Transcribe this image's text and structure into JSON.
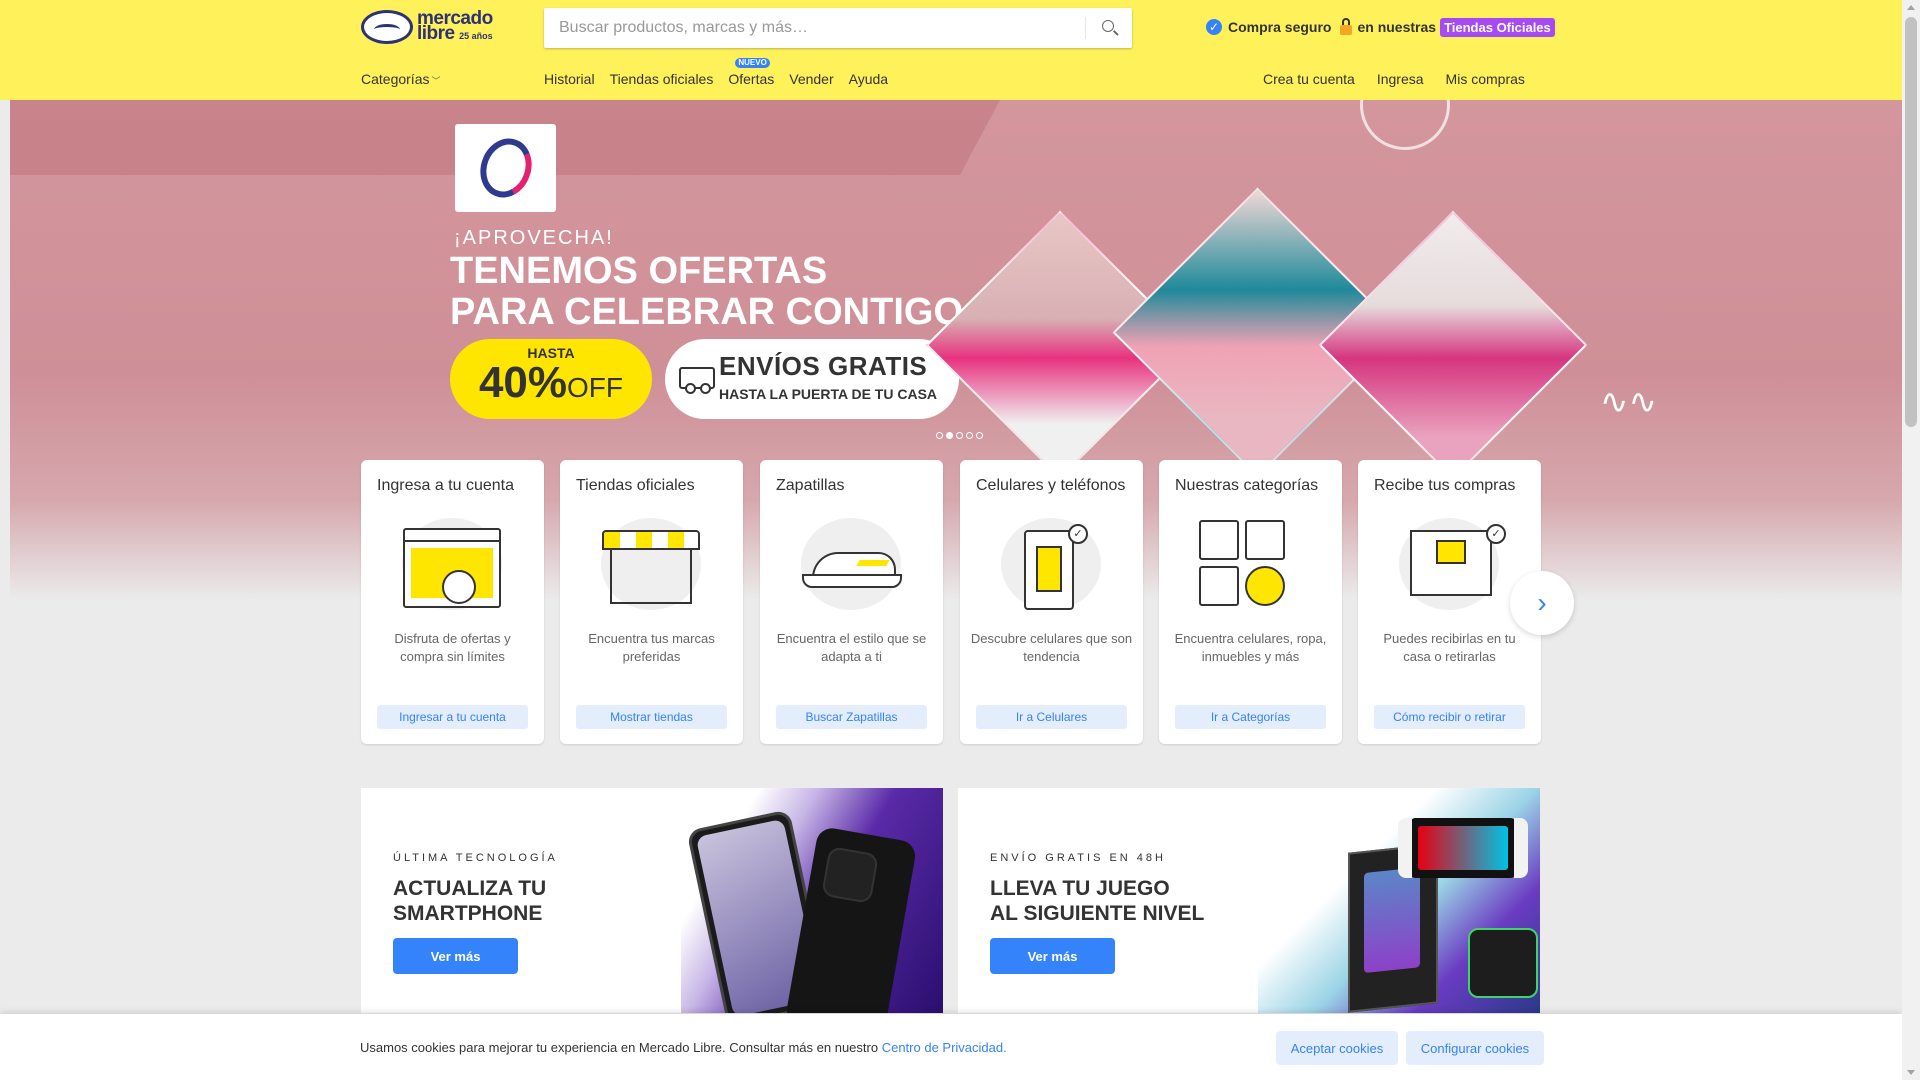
{
  "header": {
    "logo": {
      "line1": "mercado",
      "line2": "libre",
      "badge": "25 años"
    },
    "search": {
      "placeholder": "Buscar productos, marcas y más…",
      "value": ""
    },
    "promo": {
      "compra": "Compra seguro",
      "en": "en nuestras",
      "tag": "Tiendas Oficiales"
    },
    "categories_label": "Categorías",
    "nav_links": [
      "Historial",
      "Tiendas oficiales",
      "Ofertas",
      "Vender",
      "Ayuda"
    ],
    "nuevo_badge": "NUEVO",
    "account_links": [
      "Crea tu cuenta",
      "Ingresa",
      "Mis compras"
    ]
  },
  "hero": {
    "eyebrow": "¡APROVECHA!",
    "headline_1": "TENEMOS OFERTAS",
    "headline_2": "PARA CELEBRAR CONTIGO",
    "discount_hasta": "HASTA",
    "discount_value": "40%",
    "discount_off": "OFF",
    "shipping_title": "ENVÍOS GRATIS",
    "shipping_sub": "HASTA LA PUERTA DE TU CASA",
    "carousel_dots": 5,
    "carousel_active": 2
  },
  "cards": [
    {
      "title": "Ingresa a tu cuenta",
      "desc": "Disfruta de ofertas y compra sin límites",
      "cta": "Ingresar a tu cuenta"
    },
    {
      "title": "Tiendas oficiales",
      "desc": "Encuentra tus marcas preferidas",
      "cta": "Mostrar tiendas"
    },
    {
      "title": "Zapatillas",
      "desc": "Encuentra el estilo que se adapta a ti",
      "cta": "Buscar Zapatillas"
    },
    {
      "title": "Celulares y teléfonos",
      "desc": "Descubre celulares que son tendencia",
      "cta": "Ir a Celulares"
    },
    {
      "title": "Nuestras categorías",
      "desc": "Encuentra celulares, ropa, inmuebles y más",
      "cta": "Ir a Categorías"
    },
    {
      "title": "Recibe tus compras",
      "desc": "Puedes recibirlas en tu casa o retirarlas",
      "cta": "Cómo recibir o retirar"
    }
  ],
  "banners": [
    {
      "kicker": "ÚLTIMA TECNOLOGÍA",
      "title_1": "ACTUALIZA TU",
      "title_2": "SMARTPHONE",
      "cta": "Ver más"
    },
    {
      "kicker": "ENVÍO GRATIS EN 48H",
      "title_1": "LLEVA TU JUEGO",
      "title_2": "AL SIGUIENTE NIVEL",
      "cta": "Ver más"
    }
  ],
  "cookie": {
    "message": "Usamos cookies para mejorar tu experiencia en Mercado Libre. Consultar más en nuestro ",
    "link": "Centro de Privacidad.",
    "accept": "Aceptar cookies",
    "configure": "Configurar cookies"
  },
  "colors": {
    "header_bg": "#fff159",
    "accent_blue": "#3483fa",
    "tag_purple": "#a64bf4",
    "yellow": "#ffe600"
  },
  "icons": [
    "search-icon",
    "verified-check-icon",
    "lock-icon",
    "chevron-down-icon",
    "chevron-right-icon",
    "truck-icon"
  ]
}
